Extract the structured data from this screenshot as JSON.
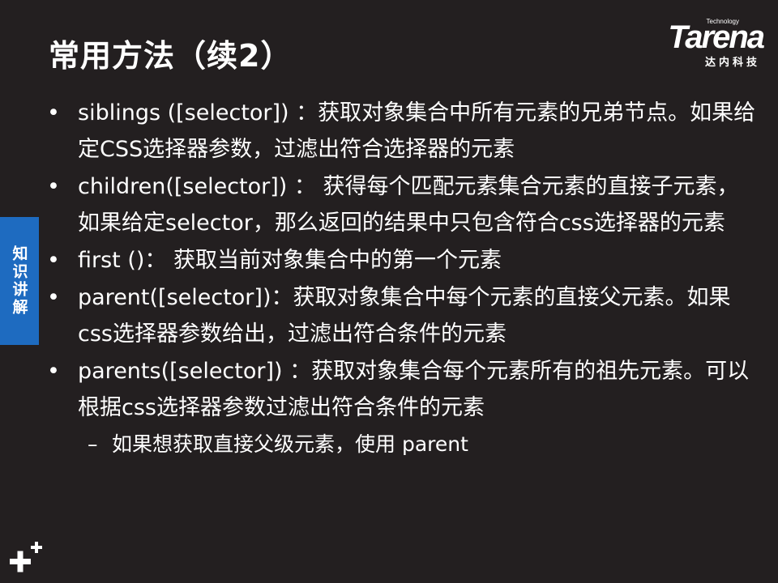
{
  "title": "常用方法（续2）",
  "logo": {
    "technology": "Technology",
    "brand": "Tarena",
    "subtitle": "达内科技"
  },
  "side_tab": "知识讲解",
  "bullet_symbol": "•",
  "sub_bullet_symbol": "–",
  "bullets": [
    "siblings ([selector]) ：获取对象集合中所有元素的兄弟节点。如果给定CSS选择器参数，过滤出符合选择器的元素",
    "children([selector]) ： 获得每个匹配元素集合元素的直接子元素，如果给定selector，那么返回的结果中只包含符合css选择器的元素",
    "first ()： 获取当前对象集合中的第一个元素",
    "parent([selector])：获取对象集合中每个元素的直接父元素。如果css选择器参数给出，过滤出符合条件的元素",
    "parents([selector]) ：获取对象集合每个元素所有的祖先元素。可以根据css选择器参数过滤出符合条件的元素"
  ],
  "sub_bullet": "如果想获取直接父级元素，使用 parent"
}
